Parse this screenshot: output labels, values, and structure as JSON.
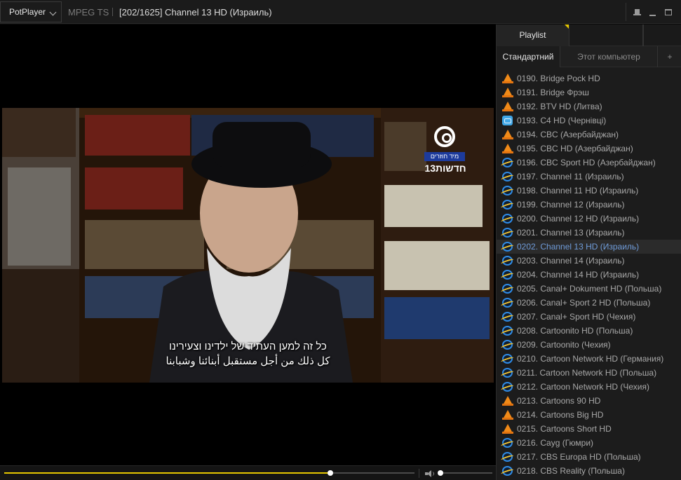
{
  "titlebar": {
    "app_name": "PotPlayer",
    "format": "MPEG TS",
    "title": "[202/1625] Channel 13 HD (Израиль)"
  },
  "video": {
    "logo_tag": "מיד חוזרים",
    "logo_name": "חדשות13",
    "subtitle_line1": "כל זה למען העתיד של ילדינו וצעירינו",
    "subtitle_line2": "كل ذلك من أجل مستقبل أبنائنا وشبابنا"
  },
  "playback": {
    "seek_fraction": 0.795,
    "volume_fraction": 0.03
  },
  "panel": {
    "tab_playlist": "Playlist",
    "tab_standard": "Стандартний",
    "tab_computer": "Этот компьютер",
    "tab_add": "+"
  },
  "colors": {
    "accent": "#e6c800",
    "selected_text": "#6f9bd8"
  },
  "playlist": [
    {
      "label": "0190. Bridge Pock HD",
      "icon": "vlc-cone-icon"
    },
    {
      "label": "0191. Bridge Фрэш",
      "icon": "vlc-cone-icon"
    },
    {
      "label": "0192. BTV HD (Литва)",
      "icon": "vlc-cone-icon"
    },
    {
      "label": "0193. C4 HD (Чернівці)",
      "icon": "network-icon"
    },
    {
      "label": "0194. CBC (Азербайджан)",
      "icon": "vlc-cone-icon"
    },
    {
      "label": "0195. CBC HD (Азербайджан)",
      "icon": "vlc-cone-icon"
    },
    {
      "label": "0196. CBC Sport HD (Азербайджан)",
      "icon": "ie-icon"
    },
    {
      "label": "0197. Channel 11 (Израиль)",
      "icon": "ie-icon"
    },
    {
      "label": "0198. Channel 11 HD (Израиль)",
      "icon": "ie-icon"
    },
    {
      "label": "0199. Channel 12 (Израиль)",
      "icon": "ie-icon"
    },
    {
      "label": "0200. Channel 12 HD (Израиль)",
      "icon": "ie-icon"
    },
    {
      "label": "0201. Channel 13 (Израиль)",
      "icon": "ie-icon"
    },
    {
      "label": "0202. Channel 13 HD (Израиль)",
      "icon": "ie-icon",
      "selected": true
    },
    {
      "label": "0203. Channel 14 (Израиль)",
      "icon": "ie-icon"
    },
    {
      "label": "0204. Channel 14 HD (Израиль)",
      "icon": "ie-icon"
    },
    {
      "label": "0205. Canal+ Dokument HD (Польша)",
      "icon": "ie-icon"
    },
    {
      "label": "0206. Canal+ Sport 2 HD (Польша)",
      "icon": "ie-icon"
    },
    {
      "label": "0207. Canal+ Sport HD (Чехия)",
      "icon": "ie-icon"
    },
    {
      "label": "0208. Cartoonito HD (Польша)",
      "icon": "ie-icon"
    },
    {
      "label": "0209. Cartoonito (Чехия)",
      "icon": "ie-icon"
    },
    {
      "label": "0210. Cartoon Network HD (Германия)",
      "icon": "ie-icon"
    },
    {
      "label": "0211. Cartoon Network HD (Польша)",
      "icon": "ie-icon"
    },
    {
      "label": "0212. Cartoon Network HD (Чехия)",
      "icon": "ie-icon"
    },
    {
      "label": "0213. Cartoons 90 HD",
      "icon": "vlc-cone-icon"
    },
    {
      "label": "0214. Cartoons Big HD",
      "icon": "vlc-cone-icon"
    },
    {
      "label": "0215. Cartoons Short HD",
      "icon": "vlc-cone-icon"
    },
    {
      "label": "0216. Cayg (Гюмри)",
      "icon": "ie-icon"
    },
    {
      "label": "0217. CBS Europa HD (Польша)",
      "icon": "ie-icon"
    },
    {
      "label": "0218. CBS Reality (Польша)",
      "icon": "ie-icon"
    }
  ]
}
